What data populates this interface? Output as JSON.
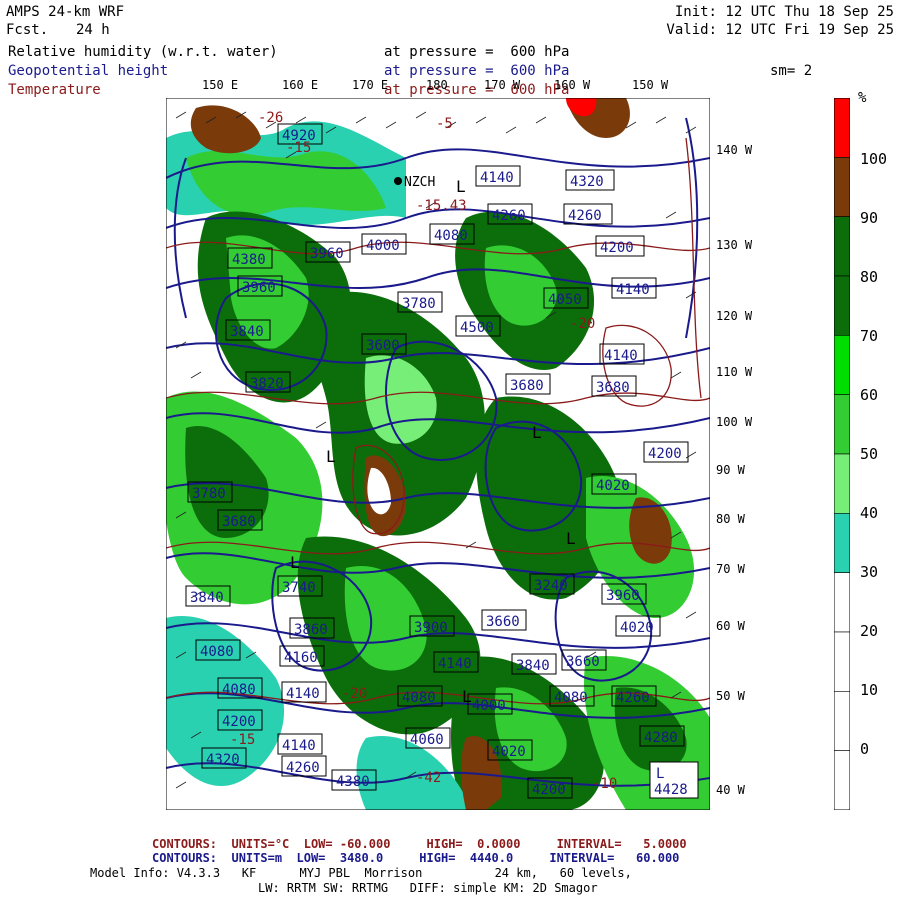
{
  "header": {
    "model": "AMPS 24-km WRF",
    "forecast_label": "Fcst.",
    "forecast_hours": "24 h",
    "init": "Init: 12 UTC Thu 18 Sep 25",
    "valid": "Valid: 12 UTC Fri 19 Sep 25"
  },
  "fields": [
    {
      "name": "Relative humidity (w.r.t. water)",
      "level": "at pressure =  600 hPa",
      "color": "#000000"
    },
    {
      "name": "Geopotential height",
      "level": "at pressure =  600 hPa",
      "color": "#1a1a8c"
    },
    {
      "name": "Temperature",
      "level": "at pressure =  600 hPa",
      "color": "#8b1a1a"
    }
  ],
  "smoothing": "sm= 2",
  "map": {
    "top_lon_labels": [
      "150 E",
      "160 E",
      "170 E",
      "180",
      "170 W",
      "160 W",
      "150 W"
    ],
    "right_lon_labels": [
      "140 W",
      "130 W",
      "120 W",
      "110 W",
      "100 W",
      "90 W",
      "80 W",
      "70 W",
      "60 W",
      "50 W",
      "40 W"
    ],
    "height_labels": [
      "4920",
      "4140",
      "4320",
      "4260",
      "4260",
      "4200",
      "4080",
      "4000",
      "4140",
      "3960",
      "3960",
      "4380",
      "3840",
      "3600",
      "3780",
      "4500",
      "4050",
      "3680",
      "3820",
      "3680",
      "4140",
      "4200",
      "4020",
      "3780",
      "3680",
      "3740",
      "3840",
      "3660",
      "3240",
      "3900",
      "3960",
      "3860",
      "4020",
      "4140",
      "4160",
      "4080",
      "3840",
      "3660",
      "4080",
      "4200",
      "4140",
      "4080",
      "4000",
      "4260",
      "4080",
      "4140",
      "4060",
      "4020",
      "4380",
      "4320",
      "4260",
      "4280",
      "4200",
      "4428"
    ],
    "temp_labels": [
      "-26",
      "-20",
      "-15",
      "-20",
      "-42",
      "-10",
      "-15.43",
      "-15",
      "-5"
    ],
    "low_markers": [
      "L",
      "L",
      "L",
      "L",
      "L",
      "L"
    ],
    "station": "NZCH"
  },
  "colorbar": {
    "unit": "%",
    "ticks": [
      "100",
      "90",
      "80",
      "70",
      "60",
      "50",
      "40",
      "30",
      "20",
      "10",
      "0"
    ],
    "bands": [
      {
        "from": 100,
        "to": 110,
        "color": "#ff0000"
      },
      {
        "from": 90,
        "to": 100,
        "color": "#7a3a0a"
      },
      {
        "from": 80,
        "to": 90,
        "color": "#0b6e0b"
      },
      {
        "from": 70,
        "to": 80,
        "color": "#0b6e0b"
      },
      {
        "from": 60,
        "to": 70,
        "color": "#00dd00"
      },
      {
        "from": 50,
        "to": 60,
        "color": "#33cc33"
      },
      {
        "from": 40,
        "to": 50,
        "color": "#77ee77"
      },
      {
        "from": 30,
        "to": 40,
        "color": "#2ad1b0"
      },
      {
        "from": 20,
        "to": 30,
        "color": "#ffffff"
      },
      {
        "from": 10,
        "to": 20,
        "color": "#ffffff"
      },
      {
        "from": 0,
        "to": 10,
        "color": "#ffffff"
      },
      {
        "from": -10,
        "to": 0,
        "color": "#ffffff"
      }
    ]
  },
  "footer": {
    "temp_contours": "CONTOURS:  UNITS=°C  LOW= -60.000     HIGH=  0.0000     INTERVAL=   5.0000",
    "height_contours": "CONTOURS:  UNITS=m  LOW=  3480.0     HIGH=  4440.0     INTERVAL=   60.000",
    "model_info": "Model Info: V4.3.3   KF      MYJ PBL  Morrison          24 km,   60 levels,",
    "physics": "LW: RRTM SW: RRTMG   DIFF: simple KM: 2D Smagor"
  },
  "colors": {
    "temp": "#8b1a1a",
    "height": "#1a1a8c",
    "rh_dark": "#0b6e0b",
    "rh_mid": "#33cc33",
    "rh_light": "#77ee77",
    "rh_cyan": "#2ad1b0",
    "rh_brown": "#7a3a0a",
    "rh_red": "#ff0000"
  }
}
